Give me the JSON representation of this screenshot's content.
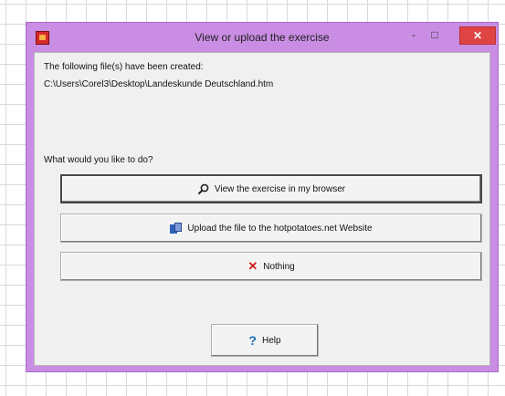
{
  "window": {
    "title": "View or upload the exercise",
    "minimize_label": "-",
    "maximize_label": "□",
    "close_label": "✕"
  },
  "content": {
    "line1": "The following file(s) have been created:",
    "line2": "C:\\Users\\Corel3\\Desktop\\Landeskunde Deutschland.htm",
    "question": "What would you like to do?"
  },
  "buttons": {
    "view": "View the exercise in my browser",
    "upload": "Upload the file to the hotpotatoes.net Website",
    "nothing": "Nothing",
    "help": "Help"
  },
  "icons": {
    "search": "search-icon",
    "upload": "upload-icon",
    "close": "x-icon",
    "help": "question-icon"
  },
  "colors": {
    "window_frame": "#c98de3",
    "close_button": "#e04343",
    "help_icon": "#1c69b3",
    "x_icon": "#d21d1d"
  }
}
